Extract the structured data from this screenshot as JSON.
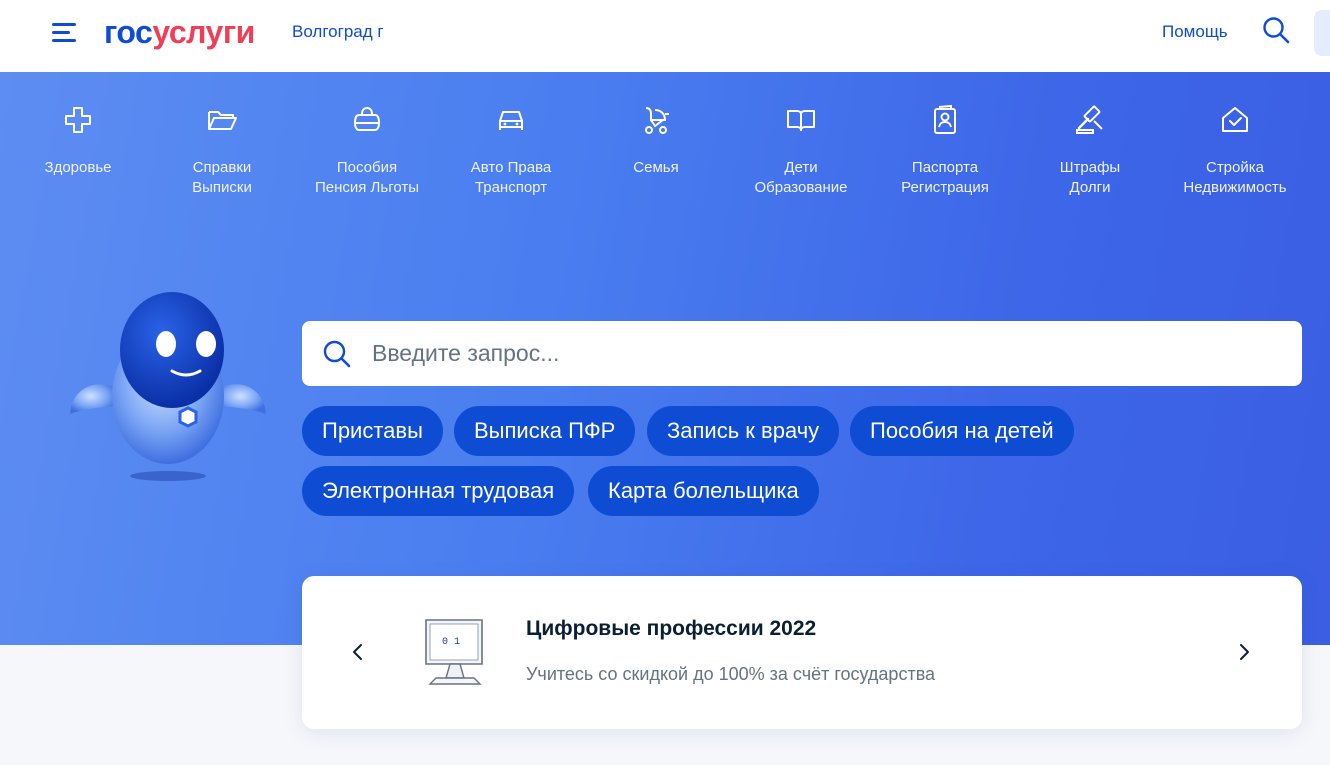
{
  "header": {
    "logo_part1": "гос",
    "logo_part2": "услуги",
    "region": "Волгоград г",
    "help": "Помощь",
    "colors": {
      "brand_blue": "#0d4cd3",
      "brand_red": "#ee3f58"
    }
  },
  "categories": [
    {
      "line1": "Здоровье",
      "line2": "",
      "icon": "health-cross-icon"
    },
    {
      "line1": "Справки",
      "line2": "Выписки",
      "icon": "folder-icon"
    },
    {
      "line1": "Пособия",
      "line2": "Пенсия Льготы",
      "icon": "purse-icon"
    },
    {
      "line1": "Авто Права",
      "line2": "Транспорт",
      "icon": "car-icon"
    },
    {
      "line1": "Семья",
      "line2": "",
      "icon": "stroller-icon"
    },
    {
      "line1": "Дети",
      "line2": "Образование",
      "icon": "book-icon"
    },
    {
      "line1": "Паспорта",
      "line2": "Регистрация",
      "icon": "passport-icon"
    },
    {
      "line1": "Штрафы",
      "line2": "Долги",
      "icon": "gavel-icon"
    },
    {
      "line1": "Стройка",
      "line2": "Недвижимость",
      "icon": "house-check-icon"
    }
  ],
  "search": {
    "placeholder": "Введите запрос..."
  },
  "chips": [
    "Приставы",
    "Выписка ПФР",
    "Запись к врачу",
    "Пособия на детей",
    "Электронная трудовая",
    "Карта болельщика"
  ],
  "banner": {
    "title": "Цифровые профессии 2022",
    "subtitle": "Учитесь со скидкой до 100% за счёт государства",
    "image_text": "0 1"
  }
}
